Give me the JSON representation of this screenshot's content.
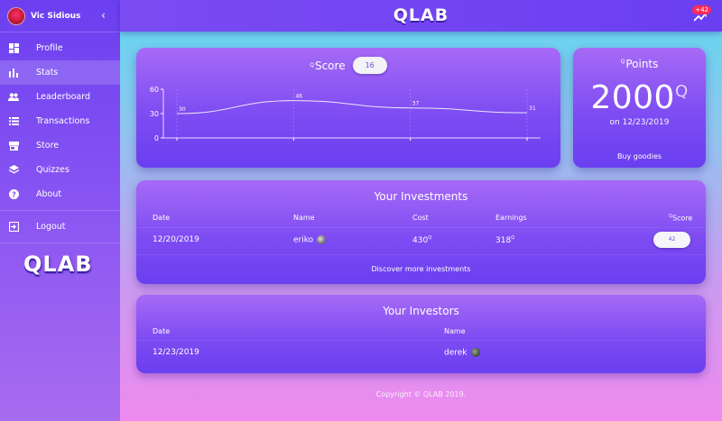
{
  "user": {
    "name": "Vic Sidious"
  },
  "header": {
    "brand": "QLAB",
    "notification_badge": "+42"
  },
  "sidebar": {
    "items": [
      {
        "label": "Profile",
        "icon": "dashboard-icon"
      },
      {
        "label": "Stats",
        "icon": "bar-chart-icon",
        "active": true
      },
      {
        "label": "Leaderboard",
        "icon": "people-icon"
      },
      {
        "label": "Transactions",
        "icon": "list-icon"
      },
      {
        "label": "Store",
        "icon": "store-icon"
      },
      {
        "label": "Quizzes",
        "icon": "layers-icon"
      },
      {
        "label": "About",
        "icon": "help-icon"
      }
    ],
    "logout_label": "Logout",
    "logo": "QLAB"
  },
  "score_card": {
    "title": "Score",
    "value": "16"
  },
  "chart_data": {
    "type": "line",
    "x": [
      0,
      1,
      2,
      3
    ],
    "values": [
      30,
      46,
      37,
      31
    ],
    "labels": [
      "30",
      "46",
      "37",
      "31"
    ],
    "yticks": [
      "60",
      "30",
      "0"
    ],
    "ylim": [
      0,
      60
    ],
    "title": "",
    "xlabel": "",
    "ylabel": ""
  },
  "points_card": {
    "title": "Points",
    "value": "2000",
    "unit": "Q",
    "date_text": "on 12/23/2019",
    "buy_label": "Buy goodies"
  },
  "investments": {
    "title": "Your Investments",
    "columns": [
      "Date",
      "Name",
      "Cost",
      "Earnings",
      "Score"
    ],
    "rows": [
      {
        "date": "12/20/2019",
        "name": "eriko",
        "cost": "430",
        "earnings": "318",
        "score": "42"
      }
    ],
    "discover_label": "Discover more investments"
  },
  "investors": {
    "title": "Your Investors",
    "columns": [
      "Date",
      "Name"
    ],
    "rows": [
      {
        "date": "12/23/2019",
        "name": "derek"
      }
    ]
  },
  "footer": {
    "text": "Copyright © QLAB 2019."
  },
  "colors": {
    "accent": "#6a3ff0",
    "badge": "#ff2a55",
    "pill_text": "#6a4fd8"
  }
}
